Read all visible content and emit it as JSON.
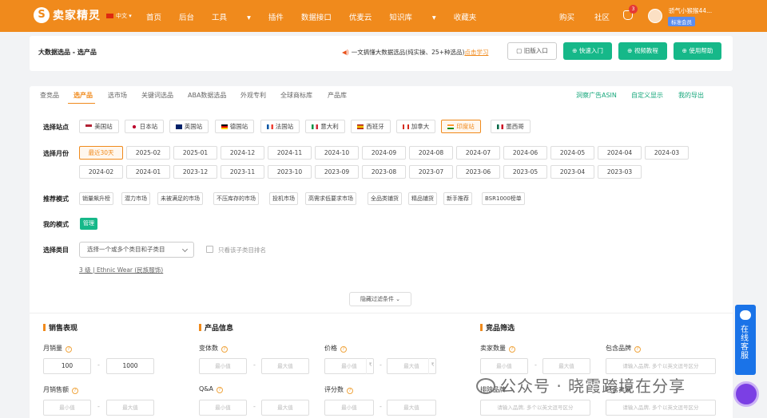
{
  "topbar": {
    "logo": "卖家精灵",
    "language": "中文",
    "nav": [
      "首页",
      "后台",
      "工具",
      "插件",
      "数据接口",
      "优麦云",
      "知识库",
      "收藏夹"
    ],
    "right": [
      "购买",
      "社区"
    ],
    "notif_count": "3",
    "username": "骄气小猴猴44...",
    "member_badge": "标准会员",
    "brand_color": "#f08a1c"
  },
  "header": {
    "breadcrumb": "大数据选品 - 选产品",
    "promo_text": "一文搞懂大数据选品(纯实操、25+种选品)",
    "promo_link": "点击学习",
    "old_entry": "旧版入口",
    "quick_start": "快速入门",
    "video_tutorial": "视频教程",
    "help": "使用帮助"
  },
  "tabs": [
    "查竞品",
    "选产品",
    "选市场",
    "关键词选品",
    "ABA数据选品",
    "外观专利",
    "全球商标库",
    "产品库"
  ],
  "tabs_right": [
    "洞察广告ASIN",
    "自定义显示",
    "我的导出"
  ],
  "filters": {
    "site_label": "选择站点",
    "sites": [
      "美国站",
      "日本站",
      "英国站",
      "德国站",
      "法国站",
      "意大利",
      "西班牙",
      "加拿大",
      "印度站",
      "墨西哥"
    ],
    "selected_site": "印度站",
    "month_label": "选择月份",
    "months_row1": [
      "最近30天",
      "2025-02",
      "2025-01",
      "2024-12",
      "2024-11",
      "2024-10",
      "2024-09",
      "2024-08",
      "2024-07",
      "2024-06",
      "2024-05",
      "2024-04",
      "2024-03"
    ],
    "months_row2": [
      "2024-02",
      "2024-01",
      "2023-12",
      "2023-11",
      "2023-10",
      "2023-09",
      "2023-08",
      "2023-07",
      "2023-06",
      "2023-05",
      "2023-04",
      "2023-03"
    ],
    "recommend_label": "推荐模式",
    "modes": [
      "销量飙升榜",
      "潜力市场",
      "未被满足的市场",
      "不压库存的市场",
      "投机市场",
      "高需求低要求市场",
      "全品类铺货",
      "精品铺货",
      "新手推荐",
      "BSR1000榜单"
    ],
    "my_mode_label": "我的模式",
    "manage": "管理",
    "category_label": "选择类目",
    "category_placeholder": "选择一个或多个类目和子类目",
    "only_subcat": "只看该子类目排名",
    "category_path": "3 级 | Ethnic Wear (民族服饰)",
    "hidden_filters": "隐藏过滤条件"
  },
  "sales": {
    "title": "销售表现",
    "monthly_sales": "月销量",
    "min_value": "100",
    "max_value": "1000",
    "monthly_revenue": "月销售额",
    "min_ph": "最小值",
    "max_ph": "最大值"
  },
  "product": {
    "title": "产品信息",
    "variants": "变体数",
    "price": "价格",
    "qa": "Q&A",
    "ratings": "评分数"
  },
  "competitor": {
    "title": "竞品筛选",
    "seller_count": "卖家数量",
    "include_brand": "包含品牌",
    "brand_ph": "请输入品牌, 多个以英文逗号区分",
    "exclude_brand": "排除品牌",
    "include_seller": "包含卖家"
  },
  "watermark": "公众号 · 晓霞跨境在分享",
  "customer_service": "在线客服"
}
